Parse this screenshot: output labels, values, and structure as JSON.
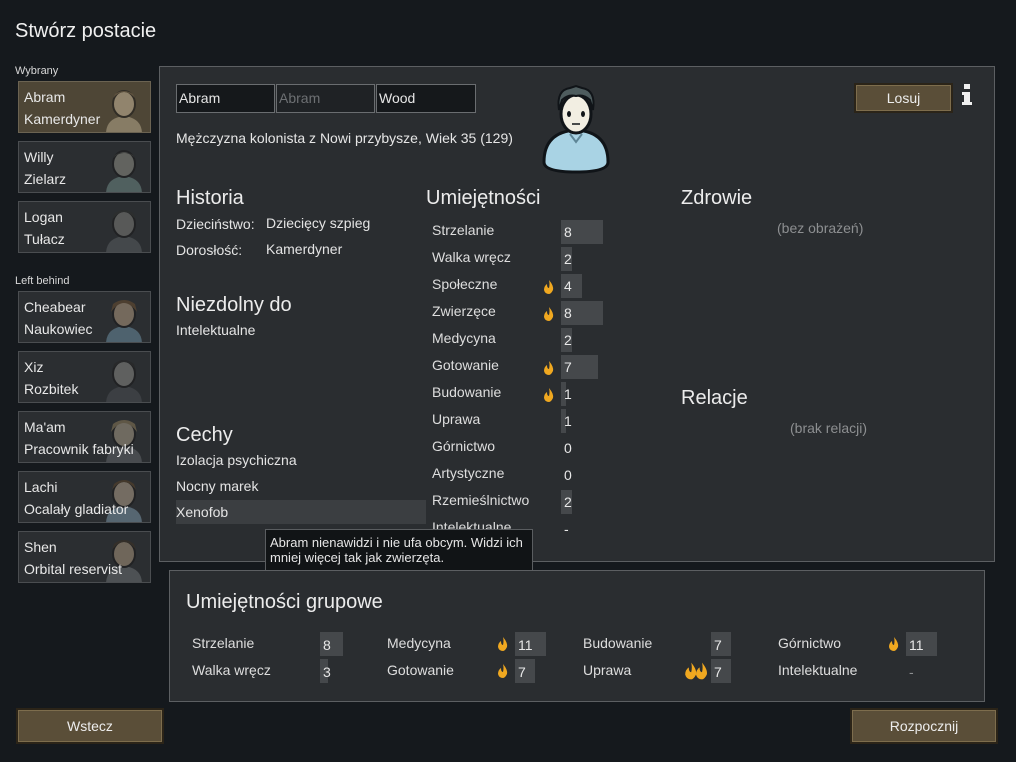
{
  "title": "Stwórz postacie",
  "sections": {
    "selected": "Wybrany",
    "left_behind": "Left behind"
  },
  "pawns": [
    {
      "name": "Abram",
      "job": "Kamerdyner"
    },
    {
      "name": "Willy",
      "job": "Zielarz"
    },
    {
      "name": "Logan",
      "job": "Tułacz"
    },
    {
      "name": "Cheabear",
      "job": "Naukowiec"
    },
    {
      "name": "Xiz",
      "job": "Rozbitek"
    },
    {
      "name": "Ma'am",
      "job": "Pracownik fabryki"
    },
    {
      "name": "Lachi",
      "job": "Ocalały gladiator"
    },
    {
      "name": "Shen",
      "job": "Orbital reservist"
    }
  ],
  "name_fields": {
    "first": "Abram",
    "nick_placeholder": "Abram",
    "last": "Wood"
  },
  "randomize_label": "Losuj",
  "description": "Mężczyzna kolonista z Nowi przybysze, Wiek 35 (129)",
  "history": {
    "heading": "Historia",
    "childhood_label": "Dzieciństwo:",
    "childhood_value": "Dziecięcy szpieg",
    "adulthood_label": "Dorosłość:",
    "adulthood_value": "Kamerdyner"
  },
  "incapable": {
    "heading": "Niezdolny do",
    "items": [
      "Intelektualne"
    ]
  },
  "traits": {
    "heading": "Cechy",
    "items": [
      "Izolacja psychiczna",
      "Nocny marek",
      "Xenofob"
    ]
  },
  "skills": {
    "heading": "Umiejętności",
    "items": [
      {
        "name": "Strzelanie",
        "level": 8,
        "passion": 0
      },
      {
        "name": "Walka wręcz",
        "level": 2,
        "passion": 0
      },
      {
        "name": "Społeczne",
        "level": 4,
        "passion": 1
      },
      {
        "name": "Zwierzęce",
        "level": 8,
        "passion": 1
      },
      {
        "name": "Medycyna",
        "level": 2,
        "passion": 0
      },
      {
        "name": "Gotowanie",
        "level": 7,
        "passion": 1
      },
      {
        "name": "Budowanie",
        "level": 1,
        "passion": 1
      },
      {
        "name": "Uprawa",
        "level": 1,
        "passion": 0
      },
      {
        "name": "Górnictwo",
        "level": 0,
        "passion": 0
      },
      {
        "name": "Artystyczne",
        "level": 0,
        "passion": 0
      },
      {
        "name": "Rzemieślnictwo",
        "level": 2,
        "passion": 0
      },
      {
        "name": "Intelektualne",
        "level": "-",
        "passion": 0
      }
    ]
  },
  "health": {
    "heading": "Zdrowie",
    "status": "(bez obrażeń)"
  },
  "relations": {
    "heading": "Relacje",
    "status": "(brak relacji)"
  },
  "tooltip": "Abram nienawidzi i nie ufa obcym. Widzi ich mniej więcej tak jak zwierzęta.",
  "group_skills": {
    "heading": "Umiejętności grupowe",
    "items": [
      {
        "name": "Strzelanie",
        "level": 8,
        "passion": 0
      },
      {
        "name": "Walka wręcz",
        "level": 3,
        "passion": 0
      },
      {
        "name": "Medycyna",
        "level": 11,
        "passion": 1
      },
      {
        "name": "Gotowanie",
        "level": 7,
        "passion": 1
      },
      {
        "name": "Budowanie",
        "level": 7,
        "passion": 0
      },
      {
        "name": "Uprawa",
        "level": 7,
        "passion": 2
      },
      {
        "name": "Górnictwo",
        "level": 11,
        "passion": 1
      },
      {
        "name": "Intelektualne",
        "level": "-",
        "passion": 0
      }
    ]
  },
  "buttons": {
    "back": "Wstecz",
    "start": "Rozpocznij"
  },
  "colors": {
    "panel": "#2a2d30",
    "button": "#5a4e38",
    "selected_card": "#4e4636",
    "flame": "#f0a820"
  }
}
